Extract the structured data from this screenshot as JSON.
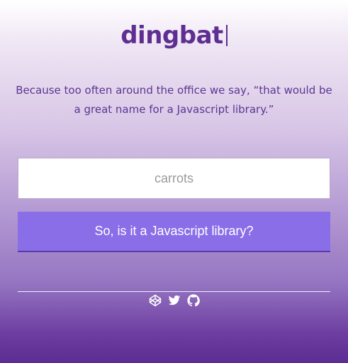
{
  "header": {
    "logo_text": "dingbat"
  },
  "tagline": "Because too often around the office we say, “that would be a great name for a Javascript library.”",
  "search": {
    "placeholder": "carrots",
    "value": ""
  },
  "submit": {
    "label": "So, is it a Javascript library?"
  },
  "footer": {
    "links": [
      {
        "icon": "codepen-icon"
      },
      {
        "icon": "twitter-icon"
      },
      {
        "icon": "github-icon"
      }
    ]
  },
  "colors": {
    "brand_purple": "#5e2e91",
    "button_violet": "#8a6ee8"
  }
}
